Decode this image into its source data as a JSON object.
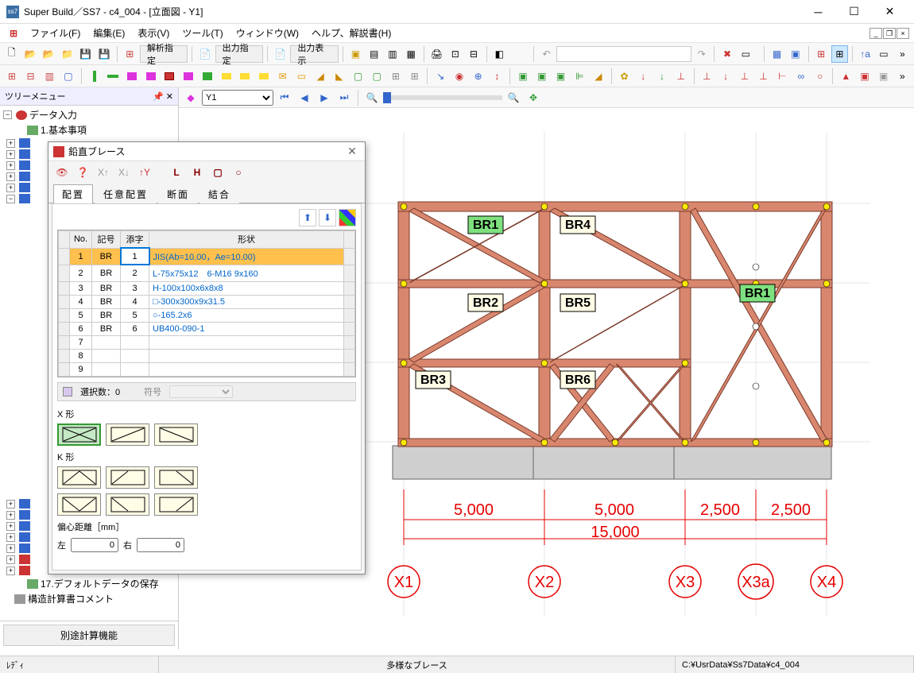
{
  "app": {
    "title": "Super Build／SS7 - c4_004 - [立面図 - Y1]",
    "icon_text": "ss7"
  },
  "menu": {
    "items": [
      "ファイル(F)",
      "編集(E)",
      "表示(V)",
      "ツール(T)",
      "ウィンドウ(W)",
      "ヘルプ、解説書(H)"
    ]
  },
  "toolbar1": {
    "btn_analysis": "解析指定",
    "btn_output_spec": "出力指定",
    "btn_output_show": "出力表示"
  },
  "canvas_toolbar": {
    "frame_select": "Y1"
  },
  "tree": {
    "header": "ツリーメニュー",
    "root": "データ入力",
    "item1": "1.基本事項",
    "item17": "17.デフォルトデータの保存",
    "comment": "構造計算書コメント",
    "btn_other_calc": "別途計算機能"
  },
  "dialog": {
    "title": "鉛直ブレース",
    "tabs": [
      "配置",
      "任意配置",
      "断面",
      "結合"
    ],
    "grid": {
      "headers": [
        "No.",
        "記号",
        "添字",
        "形状"
      ],
      "rows": [
        {
          "no": "1",
          "sym": "BR",
          "suf": "1",
          "shape": "JIS(Ab=10.00，Ae=10.00)"
        },
        {
          "no": "2",
          "sym": "BR",
          "suf": "2",
          "shape": "L-75x75x12　6-M16 9x160"
        },
        {
          "no": "3",
          "sym": "BR",
          "suf": "3",
          "shape": "H-100x100x6x8x8"
        },
        {
          "no": "4",
          "sym": "BR",
          "suf": "4",
          "shape": "□-300x300x9x31.5"
        },
        {
          "no": "5",
          "sym": "BR",
          "suf": "5",
          "shape": "○-165.2x6"
        },
        {
          "no": "6",
          "sym": "BR",
          "suf": "6",
          "shape": "UB400-090-1"
        },
        {
          "no": "7",
          "sym": "",
          "suf": "",
          "shape": ""
        },
        {
          "no": "8",
          "sym": "",
          "suf": "",
          "shape": ""
        },
        {
          "no": "9",
          "sym": "",
          "suf": "",
          "shape": ""
        }
      ]
    },
    "selcount_label": "選択数：",
    "selcount": "0",
    "sign_label": "符号",
    "x_shape": "X 形",
    "k_shape": "K 形",
    "ecc_label": "偏心距離［mm］",
    "ecc_left": "左",
    "ecc_right": "右",
    "ecc_left_val": "0",
    "ecc_right_val": "0"
  },
  "drawing": {
    "braces": [
      "BR1",
      "BR2",
      "BR3",
      "BR4",
      "BR5",
      "BR6",
      "BR1"
    ],
    "x_labels": [
      "X1",
      "X2",
      "X3",
      "X3a",
      "X4"
    ],
    "spans": [
      "5,000",
      "5,000",
      "2,500",
      "2,500"
    ],
    "total_span": "15,000"
  },
  "status": {
    "left": "ﾚﾃﾞｨ",
    "center": "多様なブレース",
    "right": "C:¥UsrData¥Ss7Data¥c4_004"
  }
}
